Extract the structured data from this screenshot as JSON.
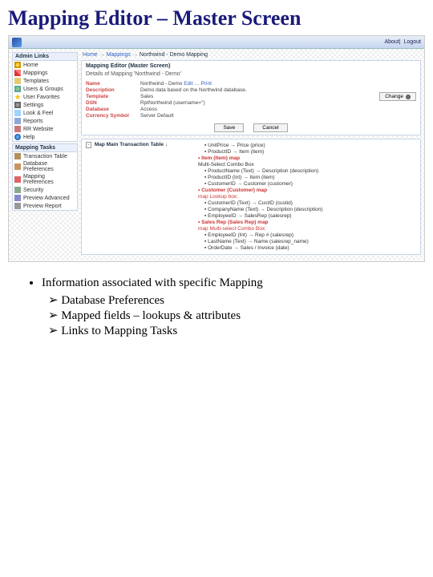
{
  "slide_title": "Mapping Editor – Master Screen",
  "topbar": {
    "about": "About",
    "logout": "Logout"
  },
  "sidebar": {
    "admin_header": "Admin Links",
    "admin_items": [
      "Home",
      "Mappings",
      "Templates",
      "Users & Groups",
      "User Favorites",
      "Settings",
      "Look & Feel",
      "Reports",
      "RR Website",
      "Help"
    ],
    "tasks_header": "Mapping Tasks",
    "tasks_items": [
      "Transaction Table",
      "Database Preferences",
      "Mapping Preferences",
      "Security",
      "Preview Advanced",
      "Preview Report"
    ]
  },
  "breadcrumb": [
    "Home",
    "Mappings",
    "Northwind - Demo Mapping"
  ],
  "card": {
    "title": "Mapping Editor (Master Screen)",
    "subtitle": "Details of Mapping 'Northwind - Demo'",
    "labels": {
      "name": "Name",
      "description": "Description",
      "template": "Template",
      "dsn": "DSN",
      "database": "Database",
      "currency": "Currency Symbol"
    },
    "values": {
      "name": "Northwind - Demo",
      "name_links": "Edit … Print",
      "description": "Demo data based on the Northwind database.",
      "template": "Sales",
      "dsn": "RptNorthwind (username='')",
      "database": "Access",
      "currency": "Server Default"
    },
    "change_btn": "Change",
    "save_btn": "Save",
    "cancel_btn": "Cancel"
  },
  "tree": {
    "root": "Map Main Transaction Table ↓",
    "right_lines": [
      "UnitPrice → Price (price)",
      "ProductID → Item (item)"
    ],
    "item_header": "• Item (Item)   map",
    "item_sub": "Multi-Select Combo Box",
    "item_lines": [
      "ProductName (Text) → Description (description)",
      "ProductID (Int) → Item (item)"
    ],
    "cust_line": "CustomerID → Customer (customer)",
    "cust_header": "• Customer (Customer)   map",
    "cust_note": "map   Lookup box:",
    "cust_lines": [
      "CustomerID (Text) → CustID (custid)",
      "CompanyName (Text) → Description (description)"
    ],
    "emp_line": "EmployeeID → SalesRep (salesrep)",
    "rep_header": "• Sales Rep (Sales Rep)   map",
    "rep_note": "map   Multi-select Combo Box:",
    "rep_lines": [
      "EmployeeID (Int) → Rep # (salesrep)",
      "LastName (Text) → Name (salesrep_name)"
    ],
    "order_line": "OrderDate → Sales / Invoice (date)"
  },
  "bullets": {
    "title": "Information associated with specific Mapping",
    "subs": [
      "Database Preferences",
      "Mapped fields – lookups & attributes",
      "Links to Mapping Tasks"
    ]
  }
}
